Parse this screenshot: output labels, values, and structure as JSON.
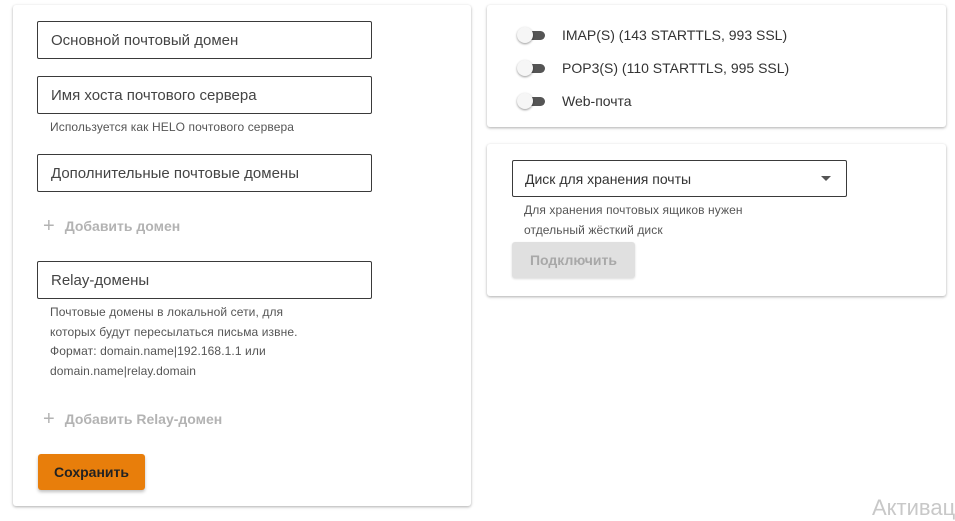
{
  "left_panel": {
    "primary_domain_placeholder": "Основной почтовый домен",
    "hostname_placeholder": "Имя хоста почтового сервера",
    "hostname_hint": "Используется как HELO почтового сервера",
    "extra_domains_placeholder": "Дополнительные почтовые домены",
    "add_domain_label": "Добавить домен",
    "relay_domains_placeholder": "Relay-домены",
    "relay_hint_lines": [
      "Почтовые домены в локальной сети, для",
      "которых будут пересылаться письма извне.",
      "Формат: domain.name|192.168.1.1 или",
      "domain.name|relay.domain"
    ],
    "add_relay_label": "Добавить Relay-домен",
    "save_label": "Сохранить",
    "save_color": "#e87e0b"
  },
  "protocols": [
    {
      "label": "IMAP(S) (143 STARTTLS, 993 SSL)",
      "enabled": false
    },
    {
      "label": "POP3(S) (110 STARTTLS, 995 SSL)",
      "enabled": false
    },
    {
      "label": "Web-почта",
      "enabled": false
    }
  ],
  "storage": {
    "select_placeholder": "Диск для хранения почты",
    "hint_lines": [
      "Для хранения почтовых ящиков нужен",
      "отдельный жёсткий диск"
    ],
    "connect_label": "Подключить"
  },
  "watermark": "Активац"
}
